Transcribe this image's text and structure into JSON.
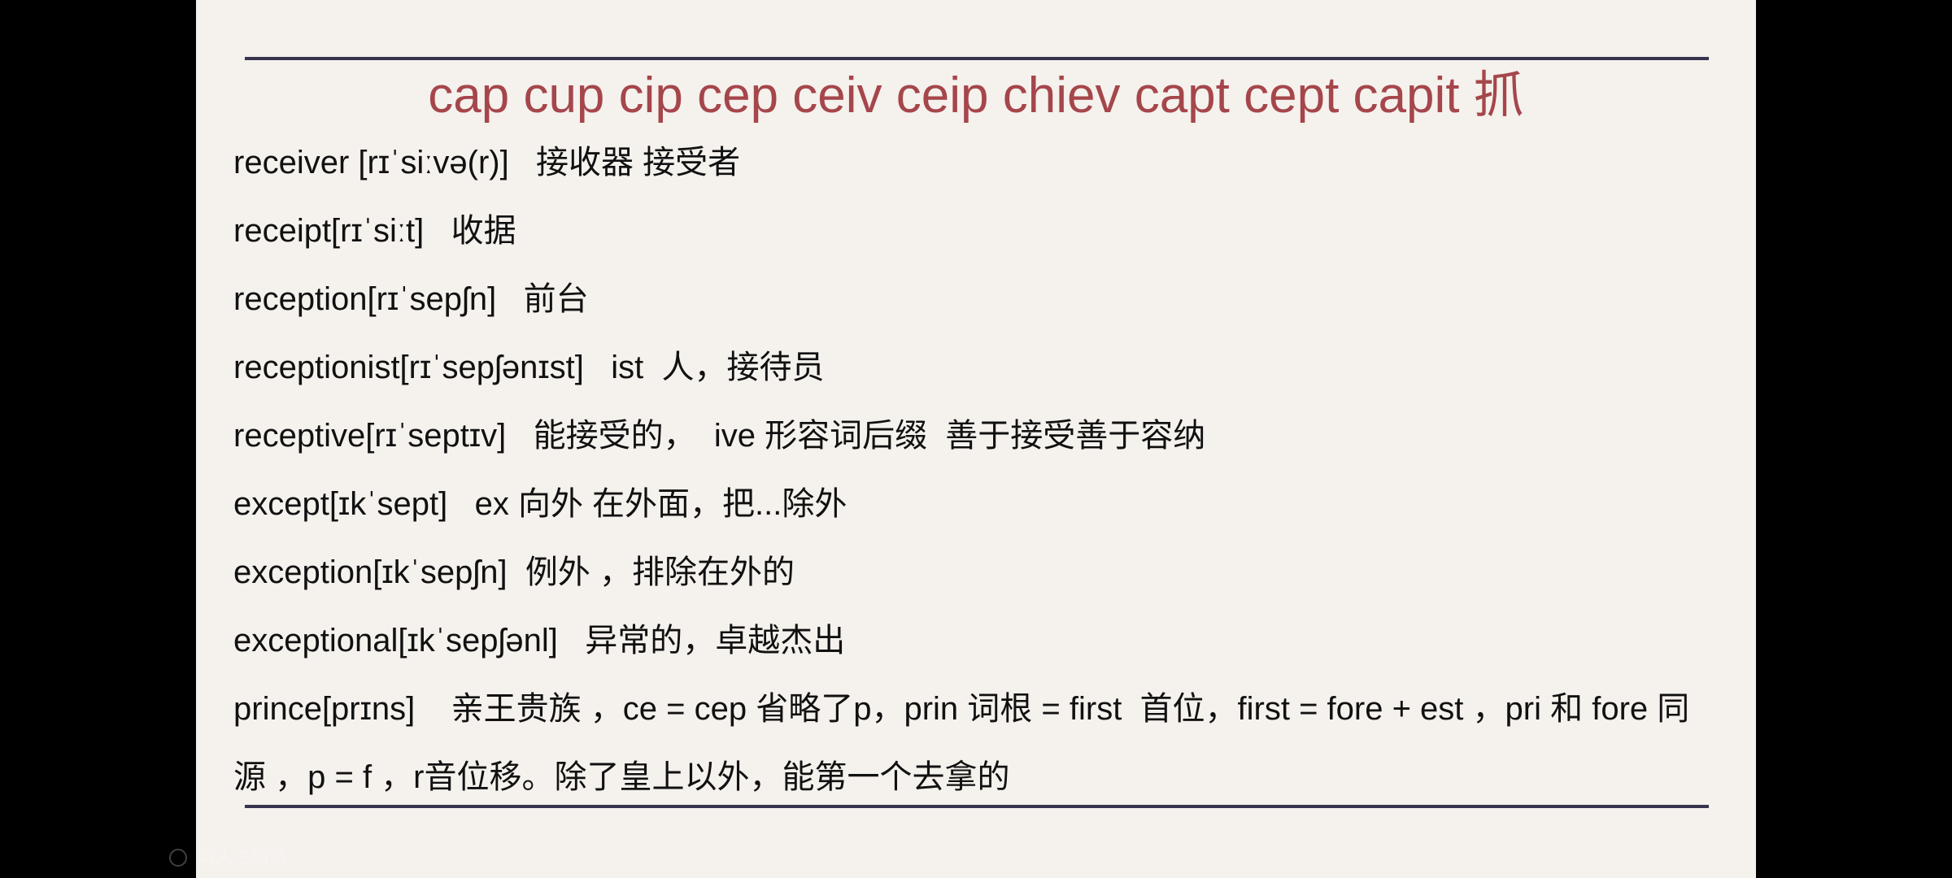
{
  "slide": {
    "title": "cap cup cip cep ceiv ceip chiev capt cept capit 抓",
    "entries": [
      "receiver [rɪˈsiːvə(r)]   接收器 接受者",
      "receipt[rɪˈsiːt]   收据",
      "reception[rɪˈsepʃn]   前台",
      "receptionist[rɪˈsepʃənɪst]   ist  人，接待员",
      "receptive[rɪˈseptɪv]   能接受的，  ive 形容词后缀  善于接受善于容纳",
      "except[ɪkˈsept]   ex 向外 在外面，把...除外",
      "exception[ɪkˈsepʃn]  例外 ，排除在外的",
      "exceptional[ɪkˈsepʃənl]   异常的，卓越杰出",
      "prince[prɪns]    亲王贵族 ，ce = cep 省略了p，prin 词根 = first  首位，first = fore + est ，pri 和 fore 同源 ，p = f ，r音位移。除了皇上以外，能第一个去拿的"
    ]
  },
  "colors": {
    "title": "#a5464b",
    "rule": "#37344f",
    "slide_background": "#f5f1ed",
    "text": "#111111"
  },
  "watermark": {
    "icon": "user-icon",
    "text": "湾人主陪落"
  }
}
